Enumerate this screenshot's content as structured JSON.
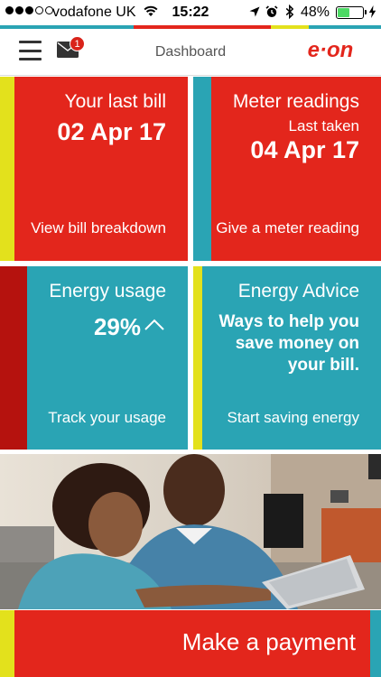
{
  "status_bar": {
    "carrier": "vodafone UK",
    "time": "15:22",
    "battery": "48%",
    "signal_bars_filled": 3,
    "signal_bars_total": 5
  },
  "colors": {
    "red": "#e3261c",
    "teal": "#2aa4b4",
    "yellow": "#e3e11c",
    "dark_red": "#b5120e"
  },
  "header": {
    "title": "Dashboard",
    "mail_badge": "1",
    "logo_text": "e·on",
    "menu_icon": "hamburger-menu-icon",
    "mail_icon": "envelope-icon"
  },
  "tiles": {
    "last_bill": {
      "title": "Your last bill",
      "date": "02 Apr 17",
      "link": "View bill breakdown"
    },
    "meter_readings": {
      "title": "Meter readings",
      "subtitle": "Last taken",
      "date": "04 Apr 17",
      "link": "Give a meter reading"
    },
    "energy_usage": {
      "title": "Energy usage",
      "value": "29%",
      "trend_icon": "chevron-up-icon",
      "link": "Track your usage"
    },
    "energy_advice": {
      "title": "Energy Advice",
      "message": "Ways to help you save money on your bill.",
      "link": "Start saving energy"
    }
  },
  "payment": {
    "label": "Make a payment"
  }
}
